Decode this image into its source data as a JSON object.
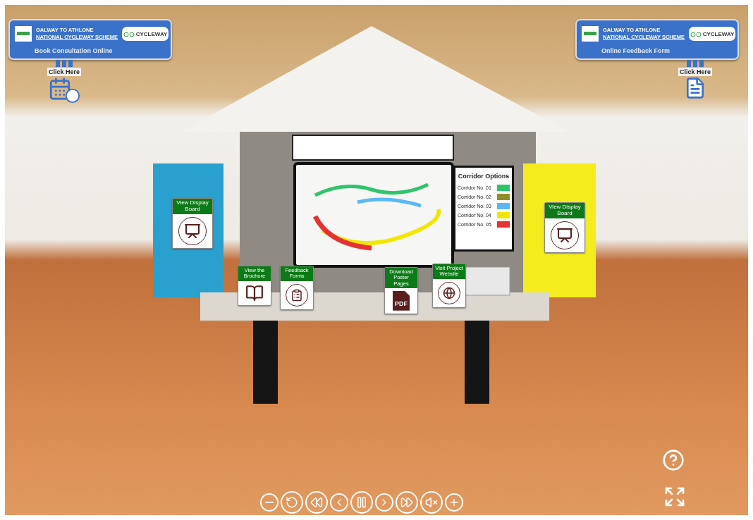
{
  "banners": [
    {
      "kind": "calendar",
      "title_lines": [
        "GALWAY TO ATHLONE",
        "NATIONAL CYCLEWAY SCHEME"
      ],
      "logo_text": "CYCLEWAY",
      "action": "Book Consultation Online",
      "cta": "Click Here"
    },
    {
      "kind": "form",
      "title_lines": [
        "GALWAY TO ATHLONE",
        "NATIONAL CYCLEWAY SCHEME"
      ],
      "logo_text": "CYCLEWAY",
      "action": "Online Feedback Form",
      "cta": "Click Here"
    }
  ],
  "display_boards": [
    {
      "label": "View Display Board"
    },
    {
      "label": "View Display Board"
    }
  ],
  "table_hotspots": [
    {
      "kind": "brochure",
      "label": "View the Brochure"
    },
    {
      "kind": "feedback",
      "label": "Feedback Forms"
    },
    {
      "kind": "pdf",
      "label": "Download Poster Pages",
      "icon_text": "PDF"
    },
    {
      "kind": "website",
      "label": "Visit Project Website"
    }
  ],
  "corridor_legend": {
    "title": "Corridor Options",
    "items": [
      {
        "label": "Corridor No. 01",
        "color": "#2ec46b"
      },
      {
        "label": "Corridor No. 02",
        "color": "#8f8f2a"
      },
      {
        "label": "Corridor No. 03",
        "color": "#5ab8f5"
      },
      {
        "label": "Corridor No. 04",
        "color": "#f2e600"
      },
      {
        "label": "Corridor No. 05",
        "color": "#e53333"
      }
    ]
  }
}
